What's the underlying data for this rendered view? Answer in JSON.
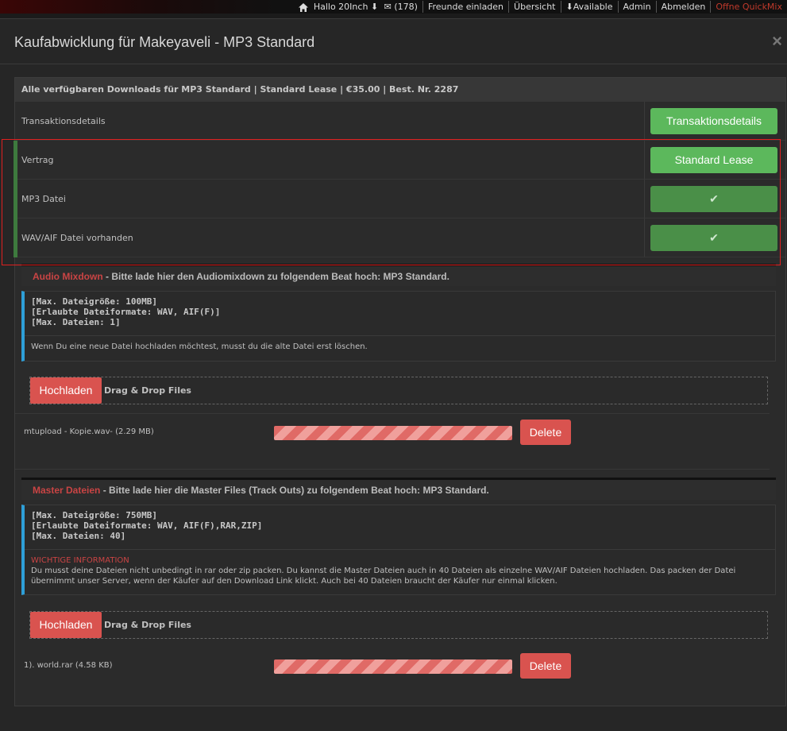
{
  "topnav": {
    "items": [
      "Hallo 20Inch",
      "(178)",
      "Freunde einladen",
      "Übersicht",
      "Available",
      "Admin",
      "Abmelden",
      "Offne QuickMix"
    ]
  },
  "modal": {
    "title": "Kaufabwicklung für Makeyaveli - MP3 Standard",
    "close": "×"
  },
  "panel": {
    "header": "Alle verfügbaren Downloads für MP3 Standard | Standard Lease | €35.00 | Best. Nr. 2287",
    "rows": [
      {
        "label": "Transaktionsdetails",
        "button": "Transaktionsdetails"
      },
      {
        "label": "Vertrag",
        "button": "Standard Lease"
      },
      {
        "label": "MP3 Datei",
        "button": "✔"
      },
      {
        "label": "WAV/AIF Datei vorhanden",
        "button": "✔"
      }
    ]
  },
  "audio": {
    "title_hl": "Audio Mixdown",
    "title_rest": " - Bitte lade hier den Audiomixdown zu folgendem Beat hoch: MP3 Standard.",
    "limits": [
      "[Max. Dateigröße: 100MB]",
      "[Erlaubte Dateiformate: WAV, AIF(F)]",
      "[Max. Dateien: 1]"
    ],
    "note": "Wenn Du eine neue Datei hochladen möchtest, musst du die alte Datei erst löschen.",
    "upload_label": "Hochladen",
    "dd_label": "Drag & Drop Files",
    "file": "mtupload - Kopie.wav- (2.29 MB)",
    "progress": 1.0,
    "delete_label": "Delete"
  },
  "master": {
    "title_hl": "Master Dateien",
    "title_rest": " - Bitte lade hier die Master Files (Track Outs) zu folgendem Beat hoch: MP3 Standard.",
    "limits": [
      "[Max. Dateigröße: 750MB]",
      "[Erlaubte Dateiformate: WAV, AIF(F),RAR,ZIP]",
      "[Max. Dateien: 40]"
    ],
    "warn_title": "WICHTIGE INFORMATION",
    "note": "Du musst deine Dateien nicht unbedingt in rar oder zip packen. Du kannst die Master Dateien auch in 40 Dateien als einzelne WAV/AIF Dateien hochladen. Das packen der Datei übernimmt unser Server, wenn der Käufer auf den Download Link klickt. Auch bei 40 Dateien braucht der Käufer nur einmal klicken.",
    "upload_label": "Hochladen",
    "dd_label": "Drag & Drop Files",
    "file": "1). world.rar (4.58 KB)",
    "progress": 1.0,
    "delete_label": "Delete"
  },
  "colors": {
    "green": "#5cb85c",
    "green_dark": "#4a8f48",
    "red": "#d9534f",
    "accent_blue": "#2e9fd8",
    "highlight": "#e0201f"
  }
}
